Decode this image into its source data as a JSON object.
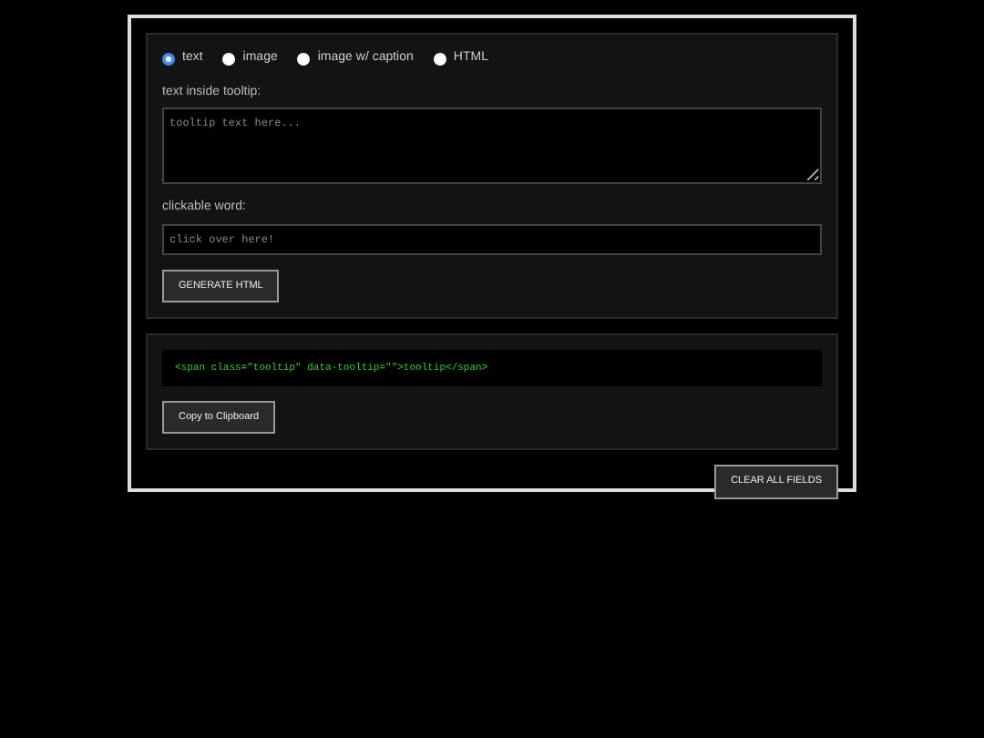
{
  "tooltip_types": [
    {
      "label": "text",
      "selected": true
    },
    {
      "label": "image",
      "selected": false
    },
    {
      "label": "image w/ caption",
      "selected": false
    },
    {
      "label": "HTML",
      "selected": false
    }
  ],
  "tooltip_text": {
    "label": "text inside tooltip:",
    "placeholder": "tooltip text here..."
  },
  "clickable_word": {
    "label": "clickable word:",
    "placeholder": "click over here!"
  },
  "generate_button": "GENERATE HTML",
  "output": {
    "code": "<span class=\"tooltip\" data-tooltip=\"\">tooltip</span>",
    "copy_button": "Copy to Clipboard"
  },
  "clear_button": "CLEAR ALL FIELDS"
}
